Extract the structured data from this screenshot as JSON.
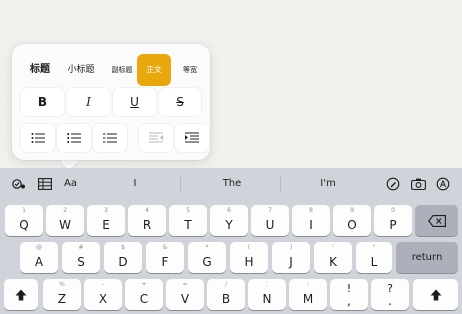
{
  "format_panel": {
    "styles": [
      "标题",
      "小标题",
      "副标题",
      "正文",
      "等宽"
    ],
    "selected_style": "正文",
    "text_formats": {
      "bold": "B",
      "italic": "I",
      "underline": "U",
      "strikethrough": "S"
    },
    "list_buttons": [
      "bulleted-list",
      "numbered-list",
      "dashed-list",
      "decrease-indent",
      "increase-indent"
    ]
  },
  "keyboard": {
    "toolbar": {
      "format_label": "Aa",
      "suggestions": [
        "I",
        "The",
        "I'm"
      ]
    },
    "row1": [
      {
        "main": "Q",
        "alt": "1"
      },
      {
        "main": "W",
        "alt": "2"
      },
      {
        "main": "E",
        "alt": "3"
      },
      {
        "main": "R",
        "alt": "4"
      },
      {
        "main": "T",
        "alt": "5"
      },
      {
        "main": "Y",
        "alt": "6"
      },
      {
        "main": "U",
        "alt": "7"
      },
      {
        "main": "I",
        "alt": "8"
      },
      {
        "main": "O",
        "alt": "9"
      },
      {
        "main": "P",
        "alt": "0"
      }
    ],
    "row2": [
      {
        "main": "A",
        "alt": "@"
      },
      {
        "main": "S",
        "alt": "#"
      },
      {
        "main": "D",
        "alt": "$"
      },
      {
        "main": "F",
        "alt": "&"
      },
      {
        "main": "G",
        "alt": "*"
      },
      {
        "main": "H",
        "alt": "("
      },
      {
        "main": "J",
        "alt": ")"
      },
      {
        "main": "K",
        "alt": "'"
      },
      {
        "main": "L",
        "alt": "\""
      }
    ],
    "return_label": "return",
    "row3": [
      {
        "main": "Z",
        "alt": "%"
      },
      {
        "main": "X",
        "alt": "-"
      },
      {
        "main": "C",
        "alt": "+"
      },
      {
        "main": "V",
        "alt": "="
      },
      {
        "main": "B",
        "alt": "/"
      },
      {
        "main": "N",
        "alt": ";"
      },
      {
        "main": "M",
        "alt": ":"
      },
      {
        "main": "!",
        "alt": ","
      },
      {
        "main": "?",
        "alt": "."
      }
    ]
  },
  "colors": {
    "accent": "#e8a70d",
    "keyboard_bg": "#d0d3d9",
    "key": "#fdfdfd",
    "dark_key": "#abb0ba"
  }
}
